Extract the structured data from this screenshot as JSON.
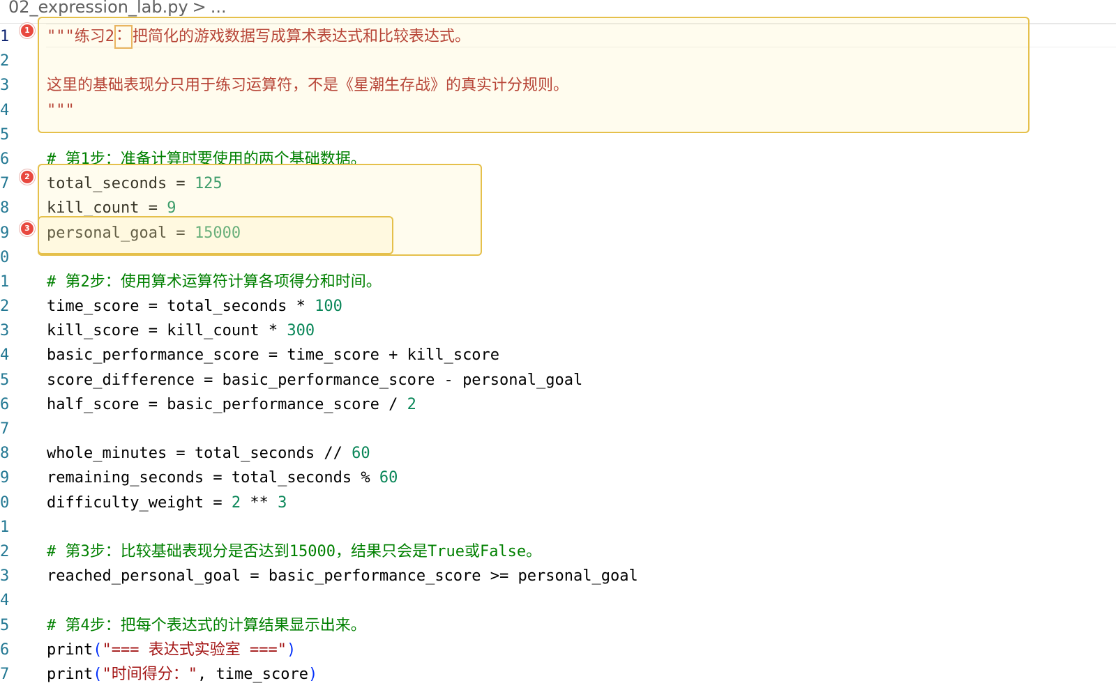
{
  "breadcrumb": {
    "file": "02_expression_lab.py",
    "separator": ">",
    "more": "..."
  },
  "markers": [
    "1",
    "2",
    "3"
  ],
  "lines": [
    {
      "n": "1",
      "tokens": [
        [
          "str",
          "\"\"\"练习2"
        ],
        [
          "str-cursor",
          "："
        ],
        [
          "str",
          "把简化的游戏数据写成算术表达式和比较表达式。"
        ]
      ]
    },
    {
      "n": "2",
      "tokens": []
    },
    {
      "n": "3",
      "tokens": [
        [
          "str",
          "这里的基础表现分只用于练习运算符，不是《星潮生存战》的真实计分规则。"
        ]
      ]
    },
    {
      "n": "4",
      "tokens": [
        [
          "str",
          "\"\"\""
        ]
      ]
    },
    {
      "n": "5",
      "tokens": []
    },
    {
      "n": "6",
      "tokens": [
        [
          "com",
          "# 第1步：准备计算时要使用的两个基础数据。"
        ]
      ]
    },
    {
      "n": "7",
      "tokens": [
        [
          "id",
          "total_seconds"
        ],
        [
          "op",
          " = "
        ],
        [
          "num",
          "125"
        ]
      ]
    },
    {
      "n": "8",
      "tokens": [
        [
          "id",
          "kill_count"
        ],
        [
          "op",
          " = "
        ],
        [
          "num",
          "9"
        ]
      ]
    },
    {
      "n": "9",
      "tokens": [
        [
          "id",
          "personal_goal"
        ],
        [
          "op",
          " = "
        ],
        [
          "num",
          "15000"
        ]
      ]
    },
    {
      "n": "0",
      "tokens": []
    },
    {
      "n": "1",
      "tokens": [
        [
          "com",
          "# 第2步：使用算术运算符计算各项得分和时间。"
        ]
      ]
    },
    {
      "n": "2",
      "tokens": [
        [
          "id",
          "time_score"
        ],
        [
          "op",
          " = "
        ],
        [
          "id",
          "total_seconds"
        ],
        [
          "op",
          " * "
        ],
        [
          "num",
          "100"
        ]
      ]
    },
    {
      "n": "3",
      "tokens": [
        [
          "id",
          "kill_score"
        ],
        [
          "op",
          " = "
        ],
        [
          "id",
          "kill_count"
        ],
        [
          "op",
          " * "
        ],
        [
          "num",
          "300"
        ]
      ]
    },
    {
      "n": "4",
      "tokens": [
        [
          "id",
          "basic_performance_score"
        ],
        [
          "op",
          " = "
        ],
        [
          "id",
          "time_score"
        ],
        [
          "op",
          " + "
        ],
        [
          "id",
          "kill_score"
        ]
      ]
    },
    {
      "n": "5",
      "tokens": [
        [
          "id",
          "score_difference"
        ],
        [
          "op",
          " = "
        ],
        [
          "id",
          "basic_performance_score"
        ],
        [
          "op",
          " - "
        ],
        [
          "id",
          "personal_goal"
        ]
      ]
    },
    {
      "n": "6",
      "tokens": [
        [
          "id",
          "half_score"
        ],
        [
          "op",
          " = "
        ],
        [
          "id",
          "basic_performance_score"
        ],
        [
          "op",
          " / "
        ],
        [
          "num",
          "2"
        ]
      ]
    },
    {
      "n": "7",
      "tokens": []
    },
    {
      "n": "8",
      "tokens": [
        [
          "id",
          "whole_minutes"
        ],
        [
          "op",
          " = "
        ],
        [
          "id",
          "total_seconds"
        ],
        [
          "op",
          " // "
        ],
        [
          "num",
          "60"
        ]
      ]
    },
    {
      "n": "9",
      "tokens": [
        [
          "id",
          "remaining_seconds"
        ],
        [
          "op",
          " = "
        ],
        [
          "id",
          "total_seconds"
        ],
        [
          "op",
          " % "
        ],
        [
          "num",
          "60"
        ]
      ]
    },
    {
      "n": "0",
      "tokens": [
        [
          "id",
          "difficulty_weight"
        ],
        [
          "op",
          " = "
        ],
        [
          "num",
          "2"
        ],
        [
          "op",
          " ** "
        ],
        [
          "num",
          "3"
        ]
      ]
    },
    {
      "n": "1",
      "tokens": []
    },
    {
      "n": "2",
      "tokens": [
        [
          "com",
          "# 第3步：比较基础表现分是否达到15000，结果只会是True或False。"
        ]
      ]
    },
    {
      "n": "3",
      "tokens": [
        [
          "id",
          "reached_personal_goal"
        ],
        [
          "op",
          " = "
        ],
        [
          "id",
          "basic_performance_score"
        ],
        [
          "op",
          " >= "
        ],
        [
          "id",
          "personal_goal"
        ]
      ]
    },
    {
      "n": "4",
      "tokens": []
    },
    {
      "n": "5",
      "tokens": [
        [
          "com",
          "# 第4步：把每个表达式的计算结果显示出来。"
        ]
      ]
    },
    {
      "n": "6",
      "tokens": [
        [
          "id",
          "print"
        ],
        [
          "brk",
          "("
        ],
        [
          "str",
          "\"=== 表达式实验室 ===\""
        ],
        [
          "brk",
          ")"
        ]
      ]
    },
    {
      "n": "7",
      "tokens": [
        [
          "id",
          "print"
        ],
        [
          "brk",
          "("
        ],
        [
          "str",
          "\"时间得分：\""
        ],
        [
          "op",
          ", "
        ],
        [
          "id",
          "time_score"
        ],
        [
          "brk",
          ")"
        ]
      ]
    }
  ]
}
